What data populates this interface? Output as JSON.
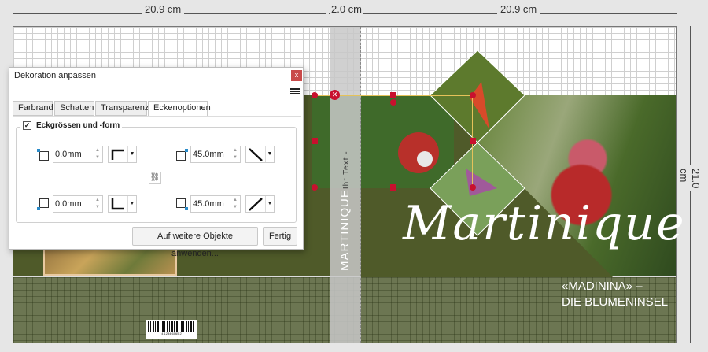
{
  "rulers": {
    "left_width": "20.9 cm",
    "spine_width": "2.0 cm",
    "right_width": "20.9 cm",
    "height": "21.0 cm"
  },
  "cover": {
    "title": "Martinique",
    "subtitle_line1": "«MADININA» –",
    "subtitle_line2": "DIE BLUMENINSEL",
    "spine_text": "MARTINIQUE",
    "spine_placeholder": "Ihr Text -",
    "barcode_text": "4 1234 6565 2",
    "colors": {
      "dark_green": "#4f5a29",
      "light_green": "#6c7652",
      "selection": "#c8102e"
    }
  },
  "dialog": {
    "title": "Dekoration anpassen",
    "close_label": "x",
    "tabs": [
      {
        "label": "Farbrand"
      },
      {
        "label": "Schatten"
      },
      {
        "label": "Transparenz"
      },
      {
        "label": "Eckenoptionen",
        "active": true
      }
    ],
    "group_label": "Eckgrössen und -form",
    "group_checked": true,
    "corners": {
      "top_left": {
        "value": "0.0mm",
        "shape": "square"
      },
      "top_right": {
        "value": "45.0mm",
        "shape": "diagonal"
      },
      "bottom_left": {
        "value": "0.0mm",
        "shape": "square"
      },
      "bottom_right": {
        "value": "45.0mm",
        "shape": "diagonal"
      }
    },
    "apply_label": "Auf weitere Objekte anwenden...",
    "done_label": "Fertig"
  }
}
